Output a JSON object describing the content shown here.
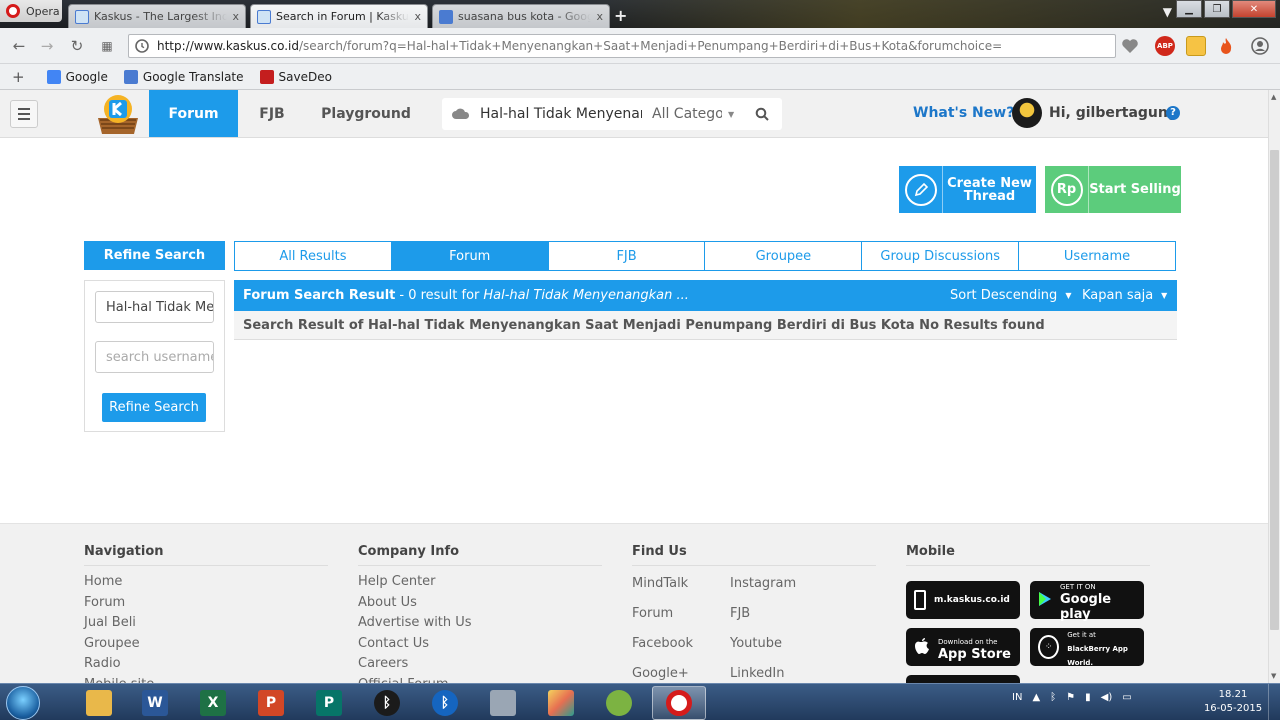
{
  "browser": {
    "app_button": "Opera",
    "tabs": [
      {
        "title": "Kaskus - The Largest Indonesian Community",
        "close": "x",
        "active": false
      },
      {
        "title": "Search in Forum | Kaskus - The Largest Indonesian Community",
        "close": "x",
        "active": true
      },
      {
        "title": "suasana bus kota - Google Search",
        "close": "x",
        "active": false
      }
    ],
    "new_tab": "+",
    "url_host": "http://www.kaskus.co.id",
    "url_path": "/search/forum?q=Hal-hal+Tidak+Menyenangkan+Saat+Menjadi+Penumpang+Berdiri+di+Bus+Kota&forumchoice=",
    "bookmarks": [
      {
        "label": "Google",
        "icon": "google-icon",
        "color": "#4285f4"
      },
      {
        "label": "Google Translate",
        "icon": "translate-icon",
        "color": "#4a7bd1"
      },
      {
        "label": "SaveDeo",
        "icon": "savedeo-icon",
        "color": "#c41e1e"
      }
    ],
    "bookmark_add": "+",
    "addon_badge": "ABP"
  },
  "header": {
    "nav": [
      {
        "label": "Forum",
        "active": true
      },
      {
        "label": "FJB",
        "active": false
      },
      {
        "label": "Playground",
        "active": false
      }
    ],
    "search_query": "Hal-hal Tidak Menyenangkan",
    "category": "All Categories",
    "whats_new": "What's New?",
    "greeting": "Hi, gilbertagung",
    "help": "?"
  },
  "actions": {
    "create_thread_line1": "Create New",
    "create_thread_line2": "Thread",
    "start_selling": "Start Selling",
    "start_selling_badge": "Rp"
  },
  "refine": {
    "title": "Refine Search",
    "query_value": "Hal-hal Tidak Menyenangkan",
    "username_placeholder": "search username",
    "button": "Refine Search"
  },
  "search_tabs": [
    {
      "label": "All Results",
      "active": false
    },
    {
      "label": "Forum",
      "active": true
    },
    {
      "label": "FJB",
      "active": false
    },
    {
      "label": "Groupee",
      "active": false
    },
    {
      "label": "Group Discussions",
      "active": false
    },
    {
      "label": "Username",
      "active": false
    }
  ],
  "results": {
    "title": "Forum Search Result",
    "count_text": "- 0 result for",
    "query_italic": "Hal-hal Tidak Menyenangkan ...",
    "sort": "Sort Descending",
    "time": "Kapan saja",
    "message": "Search Result of Hal-hal Tidak Menyenangkan Saat Menjadi Penumpang Berdiri di Bus Kota No Results found"
  },
  "footer": {
    "navigation": {
      "title": "Navigation",
      "links": [
        "Home",
        "Forum",
        "Jual Beli",
        "Groupee",
        "Radio",
        "Mobile site"
      ]
    },
    "company": {
      "title": "Company Info",
      "links": [
        "Help Center",
        "About Us",
        "Advertise with Us",
        "Contact Us",
        "Careers",
        "Official Forum"
      ]
    },
    "find_us": {
      "title": "Find Us",
      "links": [
        "MindTalk",
        "Instagram",
        "Forum",
        "FJB",
        "Facebook",
        "Youtube",
        "Google+",
        "LinkedIn"
      ]
    },
    "mobile": {
      "title": "Mobile",
      "badges": [
        {
          "small": "",
          "large": "m.kaskus.co.id"
        },
        {
          "small": "GET IT ON",
          "large": "Google play"
        },
        {
          "small": "Download on the",
          "large": "App Store"
        },
        {
          "small": "Get it at",
          "large": "BlackBerry App World."
        }
      ]
    }
  },
  "taskbar": {
    "tray_lang": "IN",
    "time": "18.21",
    "date": "16-05-2015"
  }
}
